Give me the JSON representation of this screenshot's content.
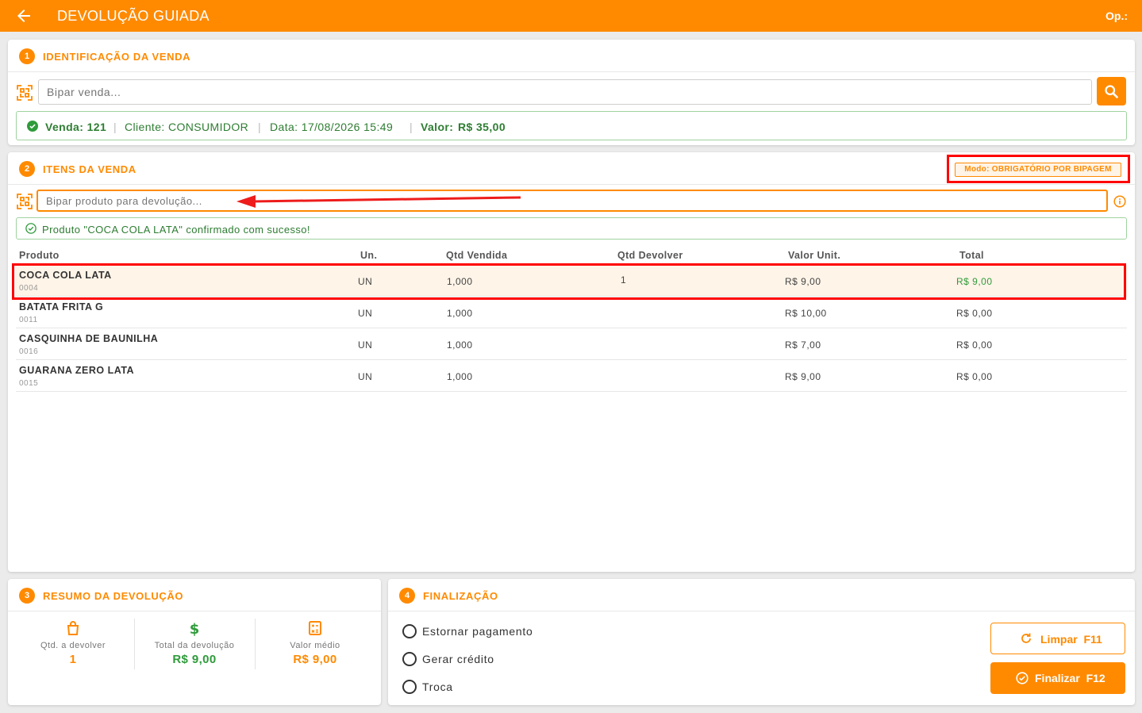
{
  "header": {
    "title": "DEVOLUÇÃO GUIADA",
    "operator": "Op.:"
  },
  "section1": {
    "step": "1",
    "title": "IDENTIFICAÇÃO DA VENDA",
    "search_placeholder": "Bipar venda...",
    "sale_info": {
      "sale": "Venda: 121",
      "client": "Cliente: CONSUMIDOR",
      "date": "Data: 17/08/2026 15:49",
      "value_label": "Valor:",
      "value": "R$ 35,00"
    }
  },
  "section2": {
    "step": "2",
    "title": "ITENS DA VENDA",
    "mode": "Modo: OBRIGATÓRIO POR BIPAGEM",
    "scan_placeholder": "Bipar produto para devolução...",
    "success_message": "Produto \"COCA COLA LATA\" confirmado com sucesso!",
    "columns": [
      "Produto",
      "Un.",
      "Qtd Vendida",
      "Qtd Devolver",
      "Valor Unit.",
      "Total"
    ],
    "rows": [
      {
        "name": "COCA COLA LATA",
        "code": "0004",
        "unit": "UN",
        "qty_sold": "1,000",
        "qty_return": "1",
        "unit_price": "R$ 9,00",
        "total": "R$ 9,00"
      },
      {
        "name": "BATATA FRITA G",
        "code": "0011",
        "unit": "UN",
        "qty_sold": "1,000",
        "qty_return": "",
        "unit_price": "R$ 10,00",
        "total": "R$ 0,00"
      },
      {
        "name": "CASQUINHA DE BAUNILHA",
        "code": "0016",
        "unit": "UN",
        "qty_sold": "1,000",
        "qty_return": "",
        "unit_price": "R$ 7,00",
        "total": "R$ 0,00"
      },
      {
        "name": "GUARANA ZERO LATA",
        "code": "0015",
        "unit": "UN",
        "qty_sold": "1,000",
        "qty_return": "",
        "unit_price": "R$ 9,00",
        "total": "R$ 0,00"
      }
    ]
  },
  "section3": {
    "step": "3",
    "title": "RESUMO DA DEVOLUÇÃO",
    "qty_label": "Qtd. a devolver",
    "qty_value": "1",
    "total_label": "Total da devolução",
    "total_value": "R$ 9,00",
    "avg_label": "Valor médio",
    "avg_value": "R$ 9,00"
  },
  "section4": {
    "step": "4",
    "title": "FINALIZAÇÃO",
    "options": [
      "Estornar pagamento",
      "Gerar crédito",
      "Troca"
    ],
    "clear_button": "Limpar  F11",
    "finish_button": "Finalizar  F12"
  },
  "colors": {
    "accent": "#ff8a00",
    "success": "#2e7d32",
    "highlight": "#ff0000"
  }
}
